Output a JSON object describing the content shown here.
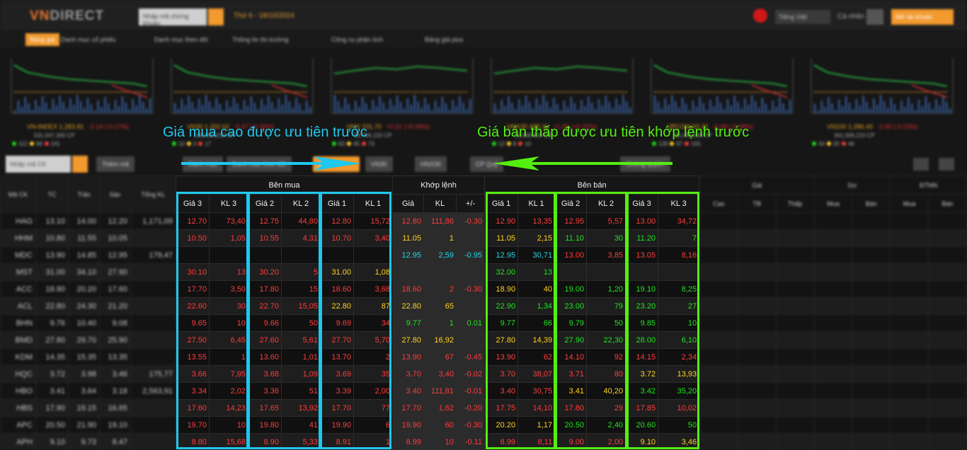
{
  "header": {
    "logo_prefix": "VN",
    "logo_rest": "DIRECT",
    "search_placeholder": "Nhập mã chứng khoán",
    "date_text": "Thứ 6 - 18/10/2024",
    "btn_lang": "Tiếng Việt",
    "user_text": "Cá nhân",
    "btn_login": "Mở tài khoản"
  },
  "menu": {
    "items": [
      "Bảng giá",
      "Danh mục cổ phiếu",
      "Danh mục theo dõi",
      "Thông tin thị trường",
      "Công cụ phân tích",
      "Bảng giá plus"
    ]
  },
  "indices": [
    {
      "name": "VN-INDEX",
      "value": "1,283.81",
      "change": "-2.14 (-0.17%)",
      "vol": "531,547,340 CP",
      "stats": "112  98  241"
    },
    {
      "name": "VN30",
      "value": "1,332.62",
      "change": "-3.47 (-0.26%)",
      "vol": "186,350,810 CP",
      "stats": "10  3  17"
    },
    {
      "name": "HNX",
      "value": "231.70",
      "change": "+0.21 (+0.09%)",
      "vol": "39,784,120 CP",
      "stats": "63  45  73"
    },
    {
      "name": "HNX30",
      "value": "498.32",
      "change": "+1.05 (+0.21%)",
      "vol": "21,008,400 CP",
      "stats": "12  8  10"
    },
    {
      "name": "UPCOM",
      "value": "93.32",
      "change": "-0.08 (-0.09%)",
      "vol": "28,146,030 CP",
      "stats": "128  97  155"
    },
    {
      "name": "VN100",
      "value": "1,286.40",
      "change": "-2.90 (-0.23%)",
      "vol": "341,006,210 CP",
      "stats": "34  20  46"
    }
  ],
  "filter": {
    "search_placeholder": "Nhập mã CK",
    "chips": [
      "Danh mục",
      "Danh mục theo dõi",
      "Lô lẻ",
      "VN30",
      "HNX30",
      "CP Quỹ",
      "Chứng quyền"
    ],
    "btn_add": "Thêm mã"
  },
  "annotations": {
    "left": "Giá mua cao được ưu tiên trước",
    "right": "Giá bán thấp được ưu tiên khớp lệnh trước"
  },
  "board": {
    "group_headers": {
      "buy": "Bên mua",
      "match": "Khớp lệnh",
      "sell": "Bên bán"
    },
    "columns": [
      "Giá 3",
      "KL 3",
      "Giá 2",
      "KL 2",
      "Giá 1",
      "KL 1",
      "Giá",
      "KL",
      "+/-",
      "Giá 1",
      "KL 1",
      "Giá 2",
      "KL 2",
      "Giá 3",
      "KL 3"
    ],
    "rows": [
      [
        [
          "12.70",
          "r"
        ],
        [
          "73,40",
          "r"
        ],
        [
          "12.75",
          "r"
        ],
        [
          "44,80",
          "r"
        ],
        [
          "12.80",
          "r"
        ],
        [
          "15,72",
          "r"
        ],
        [
          "12.80",
          "r"
        ],
        [
          "111,86",
          "r"
        ],
        [
          "-0.30",
          "r"
        ],
        [
          "12.90",
          "r"
        ],
        [
          "13,35",
          "r"
        ],
        [
          "12.95",
          "r"
        ],
        [
          "5,57",
          "r"
        ],
        [
          "13.00",
          "r"
        ],
        [
          "34,72",
          "r"
        ]
      ],
      [
        [
          "10.50",
          "r"
        ],
        [
          "1,05",
          "r"
        ],
        [
          "10.55",
          "r"
        ],
        [
          "4,31",
          "r"
        ],
        [
          "10.70",
          "r"
        ],
        [
          "3,40",
          "r"
        ],
        [
          "11.05",
          "y"
        ],
        [
          "1",
          "y"
        ],
        [
          "",
          ""
        ],
        [
          "11.05",
          "y"
        ],
        [
          "2,15",
          "y"
        ],
        [
          "11.10",
          "g"
        ],
        [
          "30",
          "g"
        ],
        [
          "11.20",
          "g"
        ],
        [
          "7",
          "g"
        ]
      ],
      [
        [
          "",
          ""
        ],
        [
          "",
          ""
        ],
        [
          "",
          ""
        ],
        [
          "",
          ""
        ],
        [
          "",
          ""
        ],
        [
          "",
          ""
        ],
        [
          "12.95",
          "c"
        ],
        [
          "2,59",
          "c"
        ],
        [
          "-0.95",
          "c"
        ],
        [
          "12.95",
          "c"
        ],
        [
          "30,71",
          "c"
        ],
        [
          "13.00",
          "r"
        ],
        [
          "3,85",
          "r"
        ],
        [
          "13.05",
          "r"
        ],
        [
          "8,16",
          "r"
        ]
      ],
      [
        [
          "30.10",
          "r"
        ],
        [
          "13",
          "r"
        ],
        [
          "30.20",
          "r"
        ],
        [
          "5",
          "r"
        ],
        [
          "31.00",
          "y"
        ],
        [
          "1,08",
          "y"
        ],
        [
          "",
          ""
        ],
        [
          "",
          ""
        ],
        [
          "",
          ""
        ],
        [
          "32.00",
          "g"
        ],
        [
          "13",
          "g"
        ],
        [
          "",
          ""
        ],
        [
          "",
          ""
        ],
        [
          "",
          ""
        ],
        [
          "",
          ""
        ]
      ],
      [
        [
          "17.70",
          "r"
        ],
        [
          "3,50",
          "r"
        ],
        [
          "17.80",
          "r"
        ],
        [
          "15",
          "r"
        ],
        [
          "18.60",
          "r"
        ],
        [
          "3,68",
          "r"
        ],
        [
          "18.60",
          "r"
        ],
        [
          "2",
          "r"
        ],
        [
          "-0.30",
          "r"
        ],
        [
          "18.90",
          "y"
        ],
        [
          "40",
          "y"
        ],
        [
          "19.00",
          "g"
        ],
        [
          "1,20",
          "g"
        ],
        [
          "19.10",
          "g"
        ],
        [
          "8,25",
          "g"
        ]
      ],
      [
        [
          "22.60",
          "r"
        ],
        [
          "30",
          "r"
        ],
        [
          "22.70",
          "r"
        ],
        [
          "15,05",
          "r"
        ],
        [
          "22.80",
          "y"
        ],
        [
          "87",
          "y"
        ],
        [
          "22.80",
          "y"
        ],
        [
          "65",
          "y"
        ],
        [
          "",
          ""
        ],
        [
          "22.90",
          "g"
        ],
        [
          "1,34",
          "g"
        ],
        [
          "23.00",
          "g"
        ],
        [
          "79",
          "g"
        ],
        [
          "23.20",
          "g"
        ],
        [
          "27",
          "g"
        ]
      ],
      [
        [
          "9.65",
          "r"
        ],
        [
          "10",
          "r"
        ],
        [
          "9.66",
          "r"
        ],
        [
          "50",
          "r"
        ],
        [
          "9.69",
          "r"
        ],
        [
          "34",
          "r"
        ],
        [
          "9.77",
          "g"
        ],
        [
          "1",
          "g"
        ],
        [
          "0.01",
          "g"
        ],
        [
          "9.77",
          "g"
        ],
        [
          "66",
          "g"
        ],
        [
          "9.79",
          "g"
        ],
        [
          "50",
          "g"
        ],
        [
          "9.85",
          "g"
        ],
        [
          "10",
          "g"
        ]
      ],
      [
        [
          "27.50",
          "r"
        ],
        [
          "6,45",
          "r"
        ],
        [
          "27.60",
          "r"
        ],
        [
          "5,61",
          "r"
        ],
        [
          "27.70",
          "r"
        ],
        [
          "5,70",
          "r"
        ],
        [
          "27.80",
          "y"
        ],
        [
          "16,92",
          "y"
        ],
        [
          "",
          ""
        ],
        [
          "27.80",
          "y"
        ],
        [
          "14,39",
          "y"
        ],
        [
          "27.90",
          "g"
        ],
        [
          "22,30",
          "g"
        ],
        [
          "28.00",
          "g"
        ],
        [
          "6,10",
          "g"
        ]
      ],
      [
        [
          "13.55",
          "r"
        ],
        [
          "1",
          "r"
        ],
        [
          "13.60",
          "r"
        ],
        [
          "1,01",
          "r"
        ],
        [
          "13.70",
          "r"
        ],
        [
          "2",
          "r"
        ],
        [
          "13.90",
          "r"
        ],
        [
          "67",
          "r"
        ],
        [
          "-0.45",
          "r"
        ],
        [
          "13.90",
          "r"
        ],
        [
          "62",
          "r"
        ],
        [
          "14.10",
          "r"
        ],
        [
          "92",
          "r"
        ],
        [
          "14.15",
          "r"
        ],
        [
          "2,34",
          "r"
        ]
      ],
      [
        [
          "3.66",
          "r"
        ],
        [
          "7,95",
          "r"
        ],
        [
          "3.68",
          "r"
        ],
        [
          "1,09",
          "r"
        ],
        [
          "3.69",
          "r"
        ],
        [
          "35",
          "r"
        ],
        [
          "3.70",
          "r"
        ],
        [
          "3,40",
          "r"
        ],
        [
          "-0.02",
          "r"
        ],
        [
          "3.70",
          "r"
        ],
        [
          "38,07",
          "r"
        ],
        [
          "3.71",
          "r"
        ],
        [
          "80",
          "r"
        ],
        [
          "3.72",
          "y"
        ],
        [
          "13,93",
          "y"
        ]
      ],
      [
        [
          "3.34",
          "r"
        ],
        [
          "2,02",
          "r"
        ],
        [
          "3.36",
          "r"
        ],
        [
          "51",
          "r"
        ],
        [
          "3.39",
          "r"
        ],
        [
          "2,00",
          "r"
        ],
        [
          "3.40",
          "r"
        ],
        [
          "111,81",
          "r"
        ],
        [
          "-0.01",
          "r"
        ],
        [
          "3.40",
          "r"
        ],
        [
          "30,75",
          "r"
        ],
        [
          "3.41",
          "y"
        ],
        [
          "40,20",
          "y"
        ],
        [
          "3.42",
          "g"
        ],
        [
          "35,20",
          "g"
        ]
      ],
      [
        [
          "17.60",
          "r"
        ],
        [
          "14,23",
          "r"
        ],
        [
          "17.65",
          "r"
        ],
        [
          "13,92",
          "r"
        ],
        [
          "17.70",
          "r"
        ],
        [
          "77",
          "r"
        ],
        [
          "17.70",
          "r"
        ],
        [
          "1,62",
          "r"
        ],
        [
          "-0.20",
          "r"
        ],
        [
          "17.75",
          "r"
        ],
        [
          "14,10",
          "r"
        ],
        [
          "17.80",
          "r"
        ],
        [
          "29",
          "r"
        ],
        [
          "17.85",
          "r"
        ],
        [
          "10,02",
          "r"
        ]
      ],
      [
        [
          "19.70",
          "r"
        ],
        [
          "10",
          "r"
        ],
        [
          "19.80",
          "r"
        ],
        [
          "41",
          "r"
        ],
        [
          "19.90",
          "r"
        ],
        [
          "6",
          "r"
        ],
        [
          "19.90",
          "r"
        ],
        [
          "60",
          "r"
        ],
        [
          "-0.30",
          "r"
        ],
        [
          "20.20",
          "y"
        ],
        [
          "1,17",
          "y"
        ],
        [
          "20.50",
          "g"
        ],
        [
          "2,40",
          "g"
        ],
        [
          "20.60",
          "g"
        ],
        [
          "50",
          "g"
        ]
      ],
      [
        [
          "8.80",
          "r"
        ],
        [
          "15,68",
          "r"
        ],
        [
          "8.90",
          "r"
        ],
        [
          "5,33",
          "r"
        ],
        [
          "8.91",
          "r"
        ],
        [
          "1",
          "r"
        ],
        [
          "8.99",
          "r"
        ],
        [
          "10",
          "r"
        ],
        [
          "-0.11",
          "r"
        ],
        [
          "8.99",
          "r"
        ],
        [
          "8,11",
          "r"
        ],
        [
          "9.00",
          "r"
        ],
        [
          "2,00",
          "r"
        ],
        [
          "9.10",
          "y"
        ],
        [
          "3,46",
          "y"
        ]
      ]
    ],
    "left_headers": [
      "Mã CK",
      "TC",
      "Trần",
      "Sàn",
      "Tổng KL"
    ],
    "left_rows": [
      [
        "HAG",
        "13.10",
        "14.00",
        "12.20",
        "1,171,09"
      ],
      [
        "HHM",
        "10.80",
        "11.55",
        "10.05",
        ""
      ],
      [
        "MDC",
        "13.90",
        "14.85",
        "12.95",
        "179,47"
      ],
      [
        "MST",
        "31.00",
        "34.10",
        "27.90",
        ""
      ],
      [
        "ACC",
        "18.90",
        "20.20",
        "17.60",
        ""
      ],
      [
        "ACL",
        "22.80",
        "24.30",
        "21.20",
        ""
      ],
      [
        "BHN",
        "9.76",
        "10.40",
        "9.08",
        ""
      ],
      [
        "BMD",
        "27.80",
        "29.70",
        "25.90",
        ""
      ],
      [
        "KDM",
        "14.35",
        "15.35",
        "13.35",
        ""
      ],
      [
        "HQC",
        "3.72",
        "3.98",
        "3.46",
        "175,77"
      ],
      [
        "HBO",
        "3.41",
        "3.64",
        "3.18",
        "2,563,91"
      ],
      [
        "HBS",
        "17.90",
        "19.15",
        "16.65",
        ""
      ],
      [
        "APC",
        "20.50",
        "21.90",
        "19.10",
        ""
      ],
      [
        "APH",
        "9.10",
        "9.73",
        "8.47",
        ""
      ]
    ],
    "right_headers": [
      "Giá",
      "Dư",
      "ĐTNN"
    ],
    "right_sub": [
      "Cao",
      "TB",
      "Thấp",
      "Mua",
      "Bán",
      "Mua",
      "Bán"
    ]
  },
  "colors": {
    "accent": "#f29a2e",
    "buy_box": "#1ec8ee",
    "sell_box": "#55ee11",
    "up": "#1ee41e",
    "down": "#ff3b3b",
    "ref": "#ffd21f",
    "ceiling": "#e020e0",
    "floor": "#1fd6e8"
  }
}
